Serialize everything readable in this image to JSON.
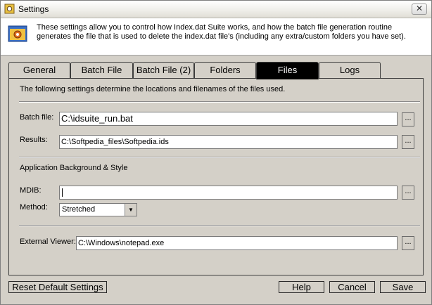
{
  "window": {
    "title": "Settings",
    "close_label": "✕"
  },
  "banner": {
    "text": "These settings allow you to control how Index.dat Suite works, and how the batch file generation routine generates the file that is used to delete the index.dat file's (including any extra/custom folders you have set)."
  },
  "tabs": [
    {
      "label": "General"
    },
    {
      "label": "Batch File"
    },
    {
      "label": "Batch File (2)"
    },
    {
      "label": "Folders"
    },
    {
      "label": "Files",
      "active": true
    },
    {
      "label": "Logs"
    }
  ],
  "panel": {
    "intro": "The following settings determine the locations and filenames of the files used.",
    "batch_file": {
      "label": "Batch file:",
      "value": "C:\\idsuite_run.bat"
    },
    "results": {
      "label": "Results:",
      "value": "C:\\Softpedia_files\\Softpedia.ids"
    },
    "background_heading": "Application Background & Style",
    "mdib": {
      "label": "MDIB:",
      "value": ""
    },
    "method": {
      "label": "Method:",
      "selected": "Stretched"
    },
    "external_viewer": {
      "label": "External Viewer:",
      "value": "C:\\Windows\\notepad.exe"
    },
    "browse_label": "..."
  },
  "buttons": {
    "reset": "Reset Default Settings",
    "help": "Help",
    "cancel": "Cancel",
    "save": "Save"
  }
}
